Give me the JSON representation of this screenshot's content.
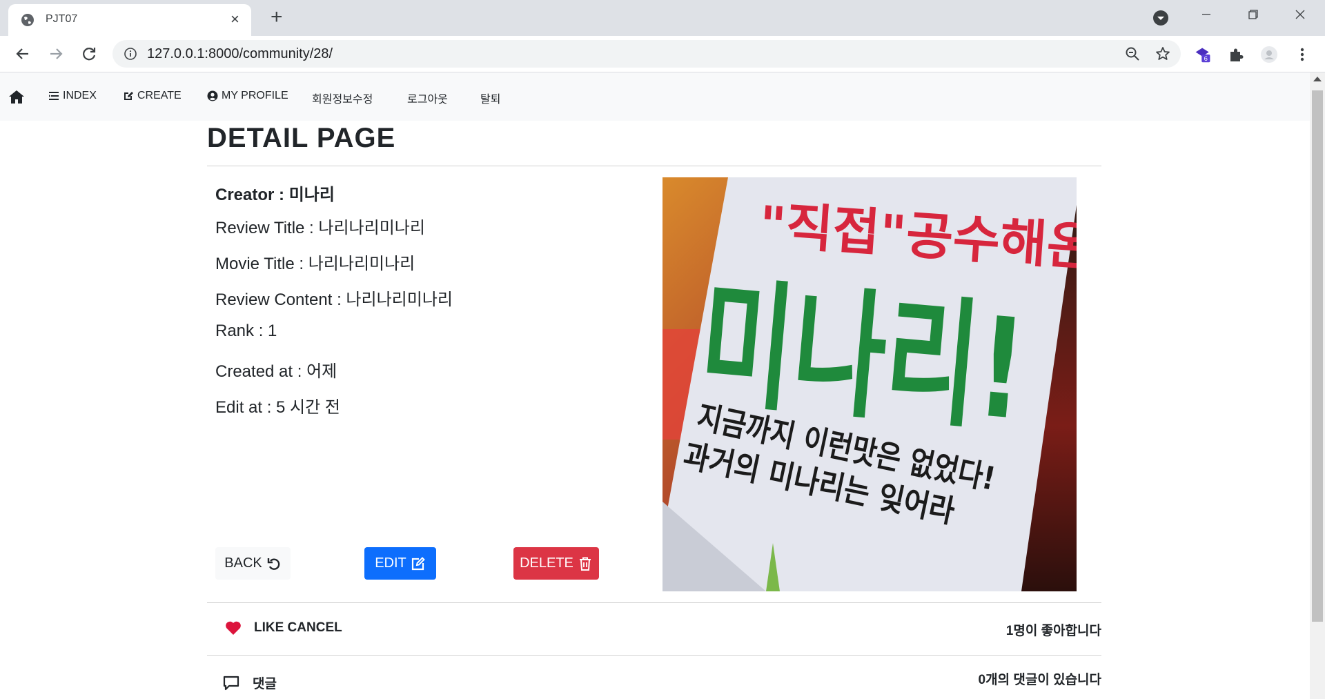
{
  "browser": {
    "tab_title": "PJT07",
    "tab_close": "×",
    "new_tab": "+",
    "url": "127.0.0.1:8000/community/28/",
    "extension_badge": "6"
  },
  "nav": {
    "items": [
      "INDEX",
      "CREATE",
      "MY PROFILE",
      "회원정보수정",
      "로그아웃",
      "탈퇴"
    ]
  },
  "page": {
    "title": "DETAIL PAGE",
    "creator_label": "Creator : ",
    "creator_value": "미나리",
    "review_title": "Review Title : 나리나리미나리",
    "movie_title": "Movie Title : 나리나리미나리",
    "review_content": "Review Content : 나리나리미나리",
    "rank": "Rank : 1",
    "created_at": "Created at : 어제",
    "edit_at": "Edit at : 5 시간 전"
  },
  "buttons": {
    "back": "BACK",
    "edit": "EDIT",
    "delete": "DELETE"
  },
  "poster": {
    "line1": "\"직접\"공수해온",
    "line2": "미나리!",
    "line3": "지금까지 이런맛은 없었다!",
    "line4": "과거의 미나리는 잊어라"
  },
  "like": {
    "label": "LIKE CANCEL",
    "count_text": "1명이 좋아합니다"
  },
  "comments": {
    "label": "댓글",
    "count_text": "0개의 댓글이 있습니다"
  },
  "colors": {
    "primary": "#0d6efd",
    "danger": "#dc3545",
    "heart": "#dc143c",
    "poster_red": "#d7263d",
    "poster_green": "#1f8a3c"
  }
}
